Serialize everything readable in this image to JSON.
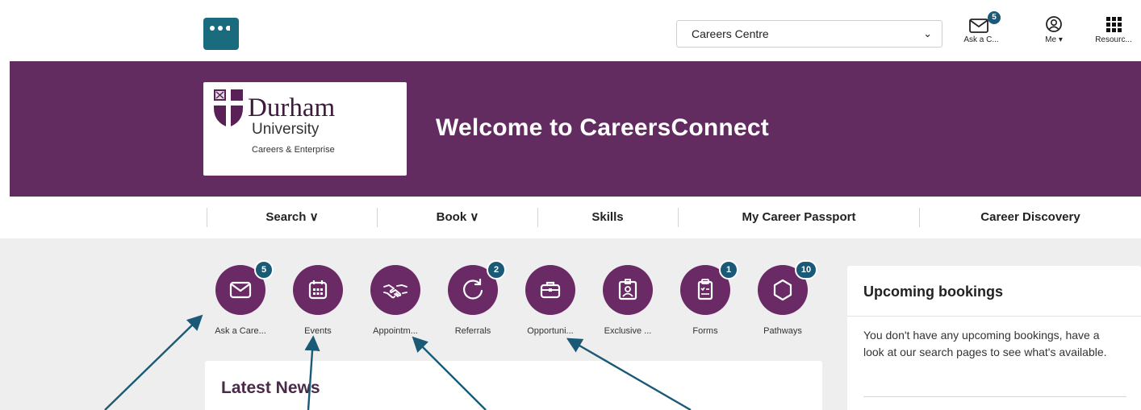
{
  "header": {
    "context_select": "Careers Centre",
    "icons": [
      {
        "name": "ask-a-careers-icon",
        "label": "Ask a C...",
        "badge": "5"
      },
      {
        "name": "me-icon",
        "label": "Me"
      },
      {
        "name": "resources-icon",
        "label": "Resourc..."
      }
    ]
  },
  "banner": {
    "brand": {
      "line1": "Durham",
      "line2": "University",
      "line3": "Careers & Enterprise"
    },
    "welcome": "Welcome to CareersConnect"
  },
  "nav": {
    "items": [
      {
        "label": "Search ∨"
      },
      {
        "label": "Book ∨"
      },
      {
        "label": "Skills"
      },
      {
        "label": "My Career Passport"
      },
      {
        "label": "Career Discovery"
      }
    ]
  },
  "tiles": [
    {
      "label": "Ask a Care...",
      "badge": "5",
      "icon": "envelope-icon"
    },
    {
      "label": "Events",
      "badge": "",
      "icon": "calendar-icon"
    },
    {
      "label": "Appointm...",
      "badge": "",
      "icon": "handshake-icon"
    },
    {
      "label": "Referrals",
      "badge": "2",
      "icon": "refresh-icon"
    },
    {
      "label": "Opportuni...",
      "badge": "",
      "icon": "briefcase-icon"
    },
    {
      "label": "Exclusive ...",
      "badge": "",
      "icon": "id-card-icon"
    },
    {
      "label": "Forms",
      "badge": "1",
      "icon": "clipboard-icon"
    },
    {
      "label": "Pathways",
      "badge": "10",
      "icon": "hexagon-icon"
    }
  ],
  "news": {
    "title": "Latest News"
  },
  "bookings": {
    "title": "Upcoming bookings",
    "message": "You don't have any upcoming bookings, have a look at our search pages to see what's available."
  },
  "colors": {
    "brand_purple": "#632c61",
    "tile_purple": "#6a2a66",
    "badge_blue": "#1b5a76",
    "arrow_blue": "#1b5a76"
  }
}
